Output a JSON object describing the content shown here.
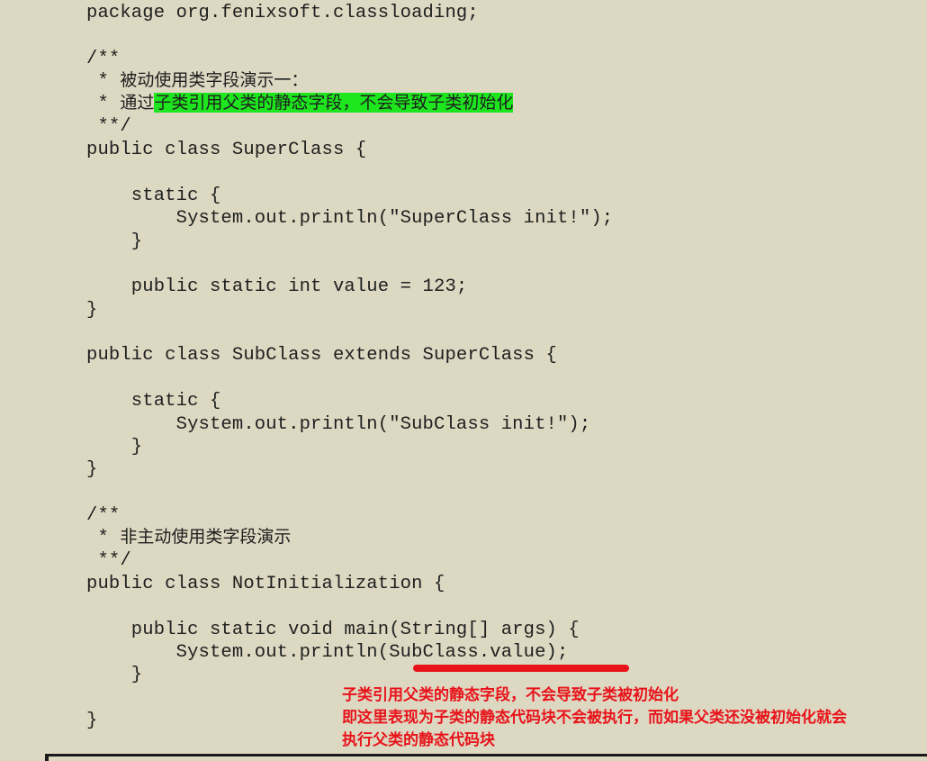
{
  "code": {
    "l1": "package org.fenixsoft.classloading;",
    "l2": "/**",
    "l3_prefix": " * ",
    "l3_text": "被动使用类字段演示一：",
    "l4_prefix": " * ",
    "l4_text": "通过",
    "l4_highlight": "子类引用父类的静态字段，不会导致子类初始化",
    "l5": " **/",
    "l6": "public class SuperClass {",
    "l7": "    static {",
    "l8": "        System.out.println(\"SuperClass init!\");",
    "l9": "    }",
    "l10": "    public static int value = 123;",
    "l11": "}",
    "l12": "public class SubClass extends SuperClass {",
    "l13": "    static {",
    "l14": "        System.out.println(\"SubClass init!\");",
    "l15": "    }",
    "l16": "}",
    "l17": "/**",
    "l18_prefix": " * ",
    "l18_text": "非主动使用类字段演示",
    "l19": " **/",
    "l20": "public class NotInitialization {",
    "l21": "    public static void main(String[] args) {",
    "l22": "        System.out.println(SubClass.value);",
    "l23": "    }",
    "l24": "}"
  },
  "annotation": {
    "line1": "子类引用父类的静态字段，不会导致子类被初始化",
    "line2": "即这里表现为子类的静态代码块不会被执行，而如果父类还没被初始化就会",
    "line3": "执行父类的静态代码块"
  },
  "colors": {
    "background": "#ddd8c2",
    "highlight": "#1ee61e",
    "annotation": "#e8131a"
  }
}
